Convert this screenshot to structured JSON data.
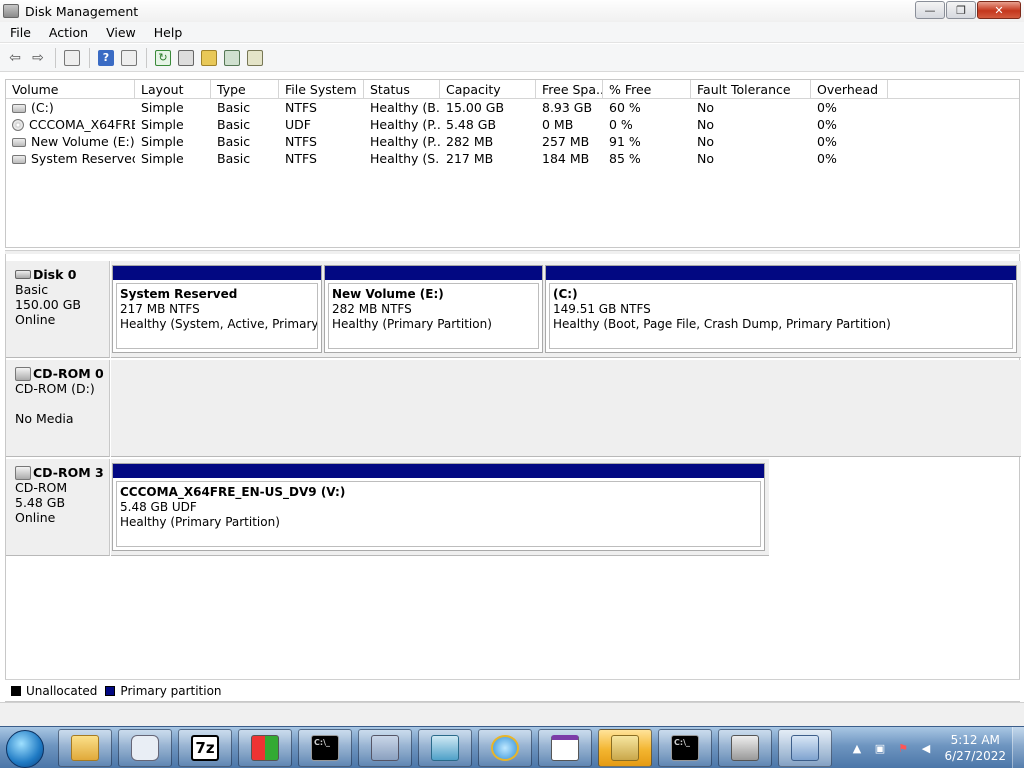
{
  "window": {
    "title": "Disk Management"
  },
  "window_buttons": {
    "minimize": "—",
    "maximize": "❐",
    "close": "✕"
  },
  "menu": [
    "File",
    "Action",
    "View",
    "Help"
  ],
  "toolbar": {
    "icons": [
      "back-arrow-icon",
      "forward-arrow-icon",
      "properties-pane-icon",
      "help-icon",
      "show-hide-pane-icon",
      "refresh-icon",
      "properties-icon",
      "open-icon",
      "explore-icon",
      "export-icon"
    ]
  },
  "volume_list": {
    "columns": [
      "Volume",
      "Layout",
      "Type",
      "File System",
      "Status",
      "Capacity",
      "Free Spa...",
      "% Free",
      "Fault Tolerance",
      "Overhead"
    ],
    "rows": [
      [
        "(C:)",
        "Simple",
        "Basic",
        "NTFS",
        "Healthy (B...",
        "15.00 GB",
        "8.93 GB",
        "60 %",
        "No",
        "0%"
      ],
      [
        "CCCOMA_X64FRE...",
        "Simple",
        "Basic",
        "UDF",
        "Healthy (P...",
        "5.48 GB",
        "0 MB",
        "0 %",
        "No",
        "0%"
      ],
      [
        "New Volume (E:)",
        "Simple",
        "Basic",
        "NTFS",
        "Healthy (P...",
        "282 MB",
        "257 MB",
        "91 %",
        "No",
        "0%"
      ],
      [
        "System Reserved",
        "Simple",
        "Basic",
        "NTFS",
        "Healthy (S...",
        "217 MB",
        "184 MB",
        "85 %",
        "No",
        "0%"
      ]
    ]
  },
  "disks": [
    {
      "name": "Disk 0",
      "line1": "Basic",
      "line2": "150.00 GB",
      "line3": "Online",
      "partitions": [
        {
          "name": "System Reserved",
          "size": "217 MB NTFS",
          "status": "Healthy (System, Active, Primary Part"
        },
        {
          "name": "New Volume  (E:)",
          "size": "282 MB NTFS",
          "status": "Healthy (Primary Partition)"
        },
        {
          "name": "(C:)",
          "size": "149.51 GB NTFS",
          "status": "Healthy (Boot, Page File, Crash Dump, Primary Partition)"
        }
      ]
    },
    {
      "name": "CD-ROM 0",
      "line1": "CD-ROM (D:)",
      "line2": "",
      "line3": "No Media",
      "partitions": []
    },
    {
      "name": "CD-ROM 3",
      "line1": "CD-ROM",
      "line2": "5.48 GB",
      "line3": "Online",
      "partitions": [
        {
          "name": "CCCOMA_X64FRE_EN-US_DV9  (V:)",
          "size": "5.48 GB UDF",
          "status": "Healthy (Primary Partition)"
        }
      ]
    }
  ],
  "legend": [
    {
      "label": "Unallocated",
      "color": "#000000"
    },
    {
      "label": "Primary partition",
      "color": "#020882"
    }
  ],
  "taskbar": {
    "apps": [
      "file-explorer-icon",
      "disk-utility-icon",
      "7zip-icon",
      "windows-setup-icon",
      "command-prompt-icon",
      "network-setup-icon",
      "download-icon",
      "internet-explorer-icon",
      "window-app-icon",
      "drive-tools-icon",
      "command-prompt-icon",
      "disk-drive-icon",
      "computer-management-icon"
    ],
    "app_7z_label": "7z",
    "app_cmd_label": "C:\\_",
    "clock_time": "5:12 AM",
    "clock_date": "6/27/2022"
  },
  "colors": {
    "partition_bar": "#020882",
    "taskbar": "#6e95c0",
    "active_app": "#f3b530"
  }
}
